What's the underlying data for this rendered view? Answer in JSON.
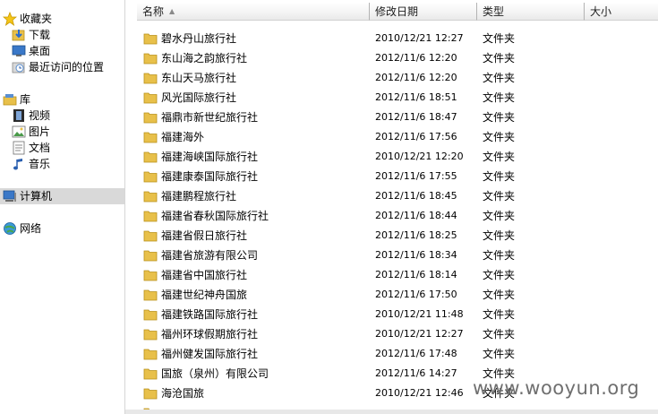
{
  "nav": {
    "favorites": "收藏夹",
    "downloads": "下载",
    "desktop": "桌面",
    "recent": "最近访问的位置",
    "libraries": "库",
    "videos": "视频",
    "pictures": "图片",
    "documents": "文档",
    "music": "音乐",
    "computer": "计算机",
    "network": "网络"
  },
  "columns": {
    "name": "名称",
    "modified": "修改日期",
    "type": "类型",
    "size": "大小"
  },
  "files": [
    {
      "name": "碧水丹山旅行社",
      "date": "2010/12/21 12:27",
      "type": "文件夹"
    },
    {
      "name": "东山海之韵旅行社",
      "date": "2012/11/6 12:20",
      "type": "文件夹"
    },
    {
      "name": "东山天马旅行社",
      "date": "2012/11/6 12:20",
      "type": "文件夹"
    },
    {
      "name": "风光国际旅行社",
      "date": "2012/11/6 18:51",
      "type": "文件夹"
    },
    {
      "name": "福鼎市新世纪旅行社",
      "date": "2012/11/6 18:47",
      "type": "文件夹"
    },
    {
      "name": "福建海外",
      "date": "2012/11/6 17:56",
      "type": "文件夹"
    },
    {
      "name": "福建海峡国际旅行社",
      "date": "2010/12/21 12:20",
      "type": "文件夹"
    },
    {
      "name": "福建康泰国际旅行社",
      "date": "2012/11/6 17:55",
      "type": "文件夹"
    },
    {
      "name": "福建鹏程旅行社",
      "date": "2012/11/6 18:45",
      "type": "文件夹"
    },
    {
      "name": "福建省春秋国际旅行社",
      "date": "2012/11/6 18:44",
      "type": "文件夹"
    },
    {
      "name": "福建省假日旅行社",
      "date": "2012/11/6 18:25",
      "type": "文件夹"
    },
    {
      "name": "福建省旅游有限公司",
      "date": "2012/11/6 18:34",
      "type": "文件夹"
    },
    {
      "name": "福建省中国旅行社",
      "date": "2012/11/6 18:14",
      "type": "文件夹"
    },
    {
      "name": "福建世纪神舟国旅",
      "date": "2012/11/6 17:50",
      "type": "文件夹"
    },
    {
      "name": "福建铁路国际旅行社",
      "date": "2010/12/21 11:48",
      "type": "文件夹"
    },
    {
      "name": "福州环球假期旅行社",
      "date": "2010/12/21 12:27",
      "type": "文件夹"
    },
    {
      "name": "福州健发国际旅行社",
      "date": "2012/11/6 17:48",
      "type": "文件夹"
    },
    {
      "name": "国旅（泉州）有限公司",
      "date": "2012/11/6 14:27",
      "type": "文件夹"
    },
    {
      "name": "海沧国旅",
      "date": "2010/12/21 12:46",
      "type": "文件夹"
    },
    {
      "name": "",
      "date": "",
      "type": ""
    }
  ],
  "watermark": "www.wooyun.org",
  "colors": {
    "folder": "#e8c04a",
    "selection": "#d9d9d9"
  }
}
